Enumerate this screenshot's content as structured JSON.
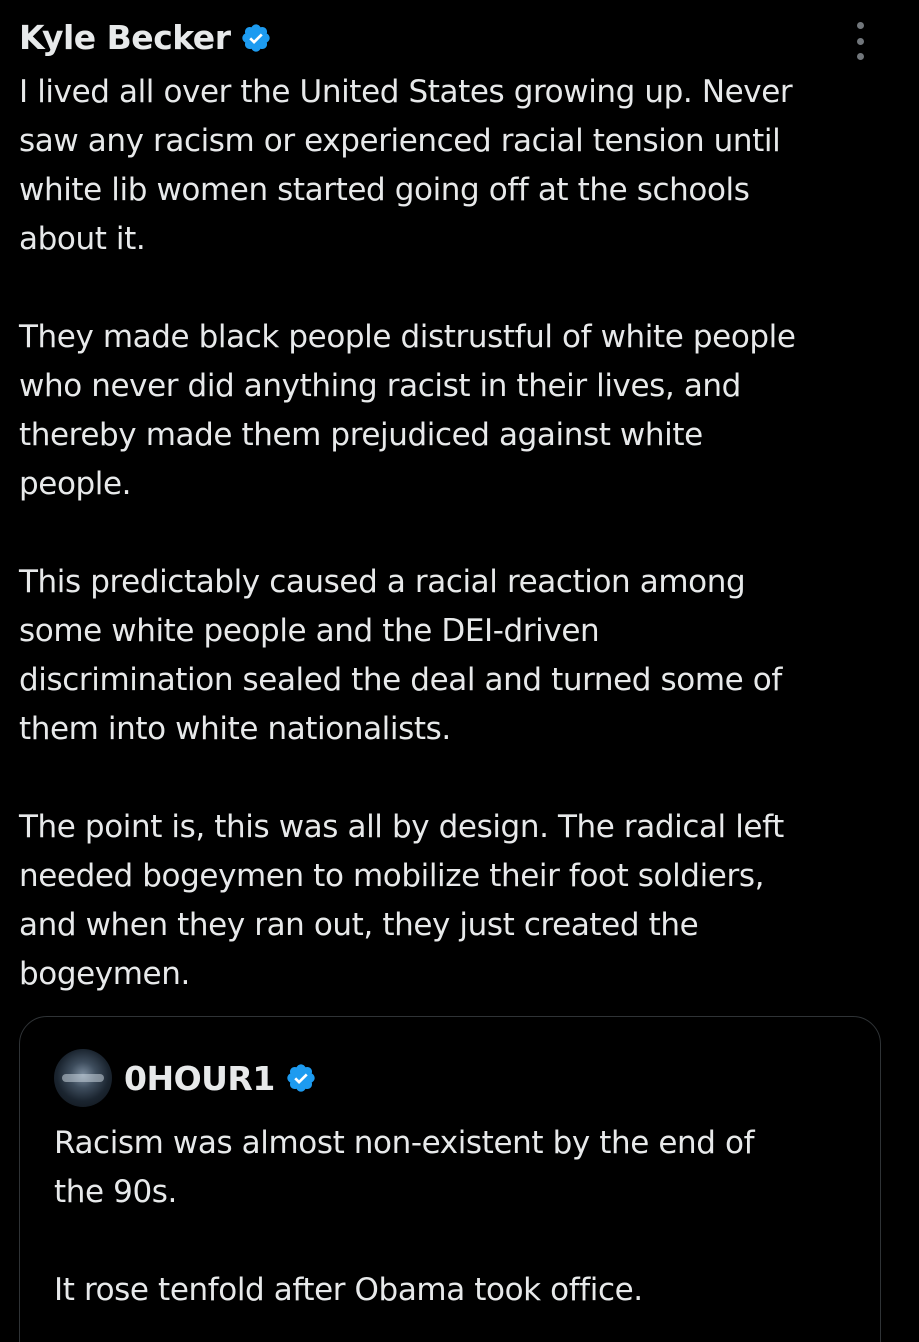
{
  "tweet": {
    "author": "Kyle Becker",
    "verified_icon": "verified-badge-icon",
    "more_icon": "more-options-icon",
    "paragraphs": [
      [
        "I lived all over the United States growing up. Never",
        "saw any racism or experienced racial tension until",
        "white lib women started going off at the schools",
        "about it."
      ],
      [
        "They made black people distrustful of white people",
        "who never did anything racist in their lives, and",
        "thereby made them prejudiced against white",
        "people."
      ],
      [
        "This predictably caused a racial reaction among",
        "some white people and the DEI-driven",
        "discrimination sealed the deal and turned some of",
        "them into white nationalists."
      ],
      [
        "The point is, this was all by design. The radical left",
        "needed bogeymen to mobilize their foot soldiers,",
        "and when they ran out, they just created the",
        "bogeymen."
      ]
    ]
  },
  "quote": {
    "author": "0HOUR1",
    "verified_icon": "verified-badge-icon",
    "paragraphs": [
      [
        "Racism was almost non-existent by the end of",
        "the 90s."
      ],
      [
        "It rose tenfold after Obama took office."
      ]
    ]
  },
  "colors": {
    "background": "#000000",
    "text": "#e7e9ea",
    "muted": "#71767b",
    "border": "#2f3336",
    "verified": "#1d9bf0"
  }
}
